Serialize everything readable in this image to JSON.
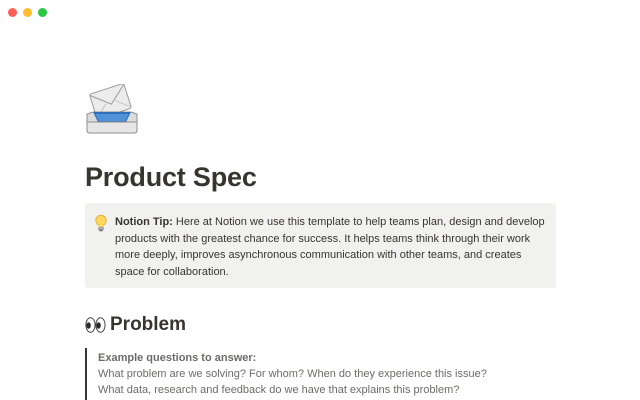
{
  "window": {
    "controls": [
      "close",
      "minimize",
      "maximize"
    ]
  },
  "page": {
    "icon": "incoming-envelope-icon",
    "title": "Product Spec"
  },
  "callout": {
    "icon": "lightbulb-icon",
    "label": "Notion Tip:",
    "text": " Here at Notion we use this template to help teams plan, design and develop products with the greatest chance for success. It helps teams think through their work more deeply, improves asynchronous communication with other teams, and creates space for collaboration."
  },
  "problem": {
    "icon": "eyes-icon",
    "heading": "Problem",
    "quote_title": "Example questions to answer:",
    "lines": [
      "What problem are we solving? For whom? When do they experience this issue?",
      "What data, research and feedback do we have that explains this problem?"
    ]
  },
  "colors": {
    "text": "#37352f",
    "callout_bg": "#f1f1ef",
    "muted": "#6b6b69"
  }
}
